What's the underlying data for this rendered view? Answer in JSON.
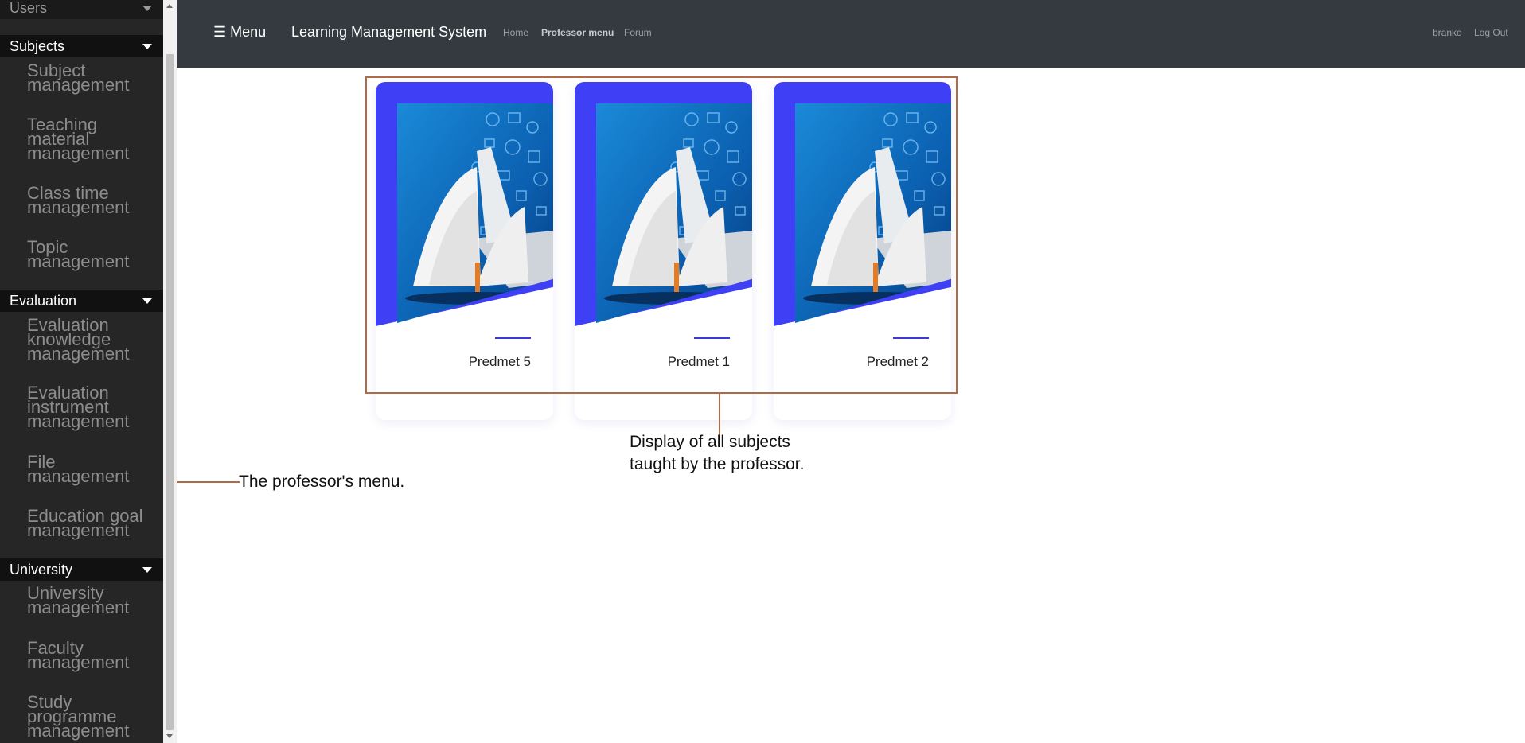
{
  "sidebar": {
    "sections": [
      {
        "title": "Users",
        "items": []
      },
      {
        "title": "Subjects",
        "items": [
          {
            "lines": [
              "Subject",
              "management"
            ]
          },
          {
            "lines": [
              "Teaching",
              "material",
              "management"
            ]
          },
          {
            "lines": [
              "Class time",
              "management"
            ]
          },
          {
            "lines": [
              "Topic",
              "management"
            ]
          }
        ]
      },
      {
        "title": "Evaluation",
        "items": [
          {
            "lines": [
              "Evaluation",
              "knowledge",
              "management"
            ]
          },
          {
            "lines": [
              "Evaluation",
              "instrument",
              "management"
            ]
          },
          {
            "lines": [
              "File",
              "management"
            ]
          },
          {
            "lines": [
              "Education goal",
              "management"
            ]
          }
        ]
      },
      {
        "title": "University",
        "items": [
          {
            "lines": [
              "University",
              "management"
            ]
          },
          {
            "lines": [
              "Faculty",
              "management"
            ]
          },
          {
            "lines": [
              "Study",
              "programme",
              "management"
            ]
          }
        ]
      }
    ]
  },
  "navbar": {
    "menu_label": "☰ Menu",
    "brand": "Learning Management System",
    "links": [
      "Home",
      "Professor menu",
      "Forum"
    ],
    "user": "branko",
    "logout": "Log Out"
  },
  "cards": [
    {
      "title": "Predmet 5"
    },
    {
      "title": "Predmet 1"
    },
    {
      "title": "Predmet 2"
    }
  ],
  "annotations": {
    "subjects": [
      "Display of all subjects",
      "taught by the professor."
    ],
    "menu": "The professor's menu."
  },
  "colors": {
    "sidebar_bg": "#262626",
    "navbar_bg": "#343a40",
    "card_accent": "#3f3ff6",
    "annotation": "#b06a48"
  }
}
